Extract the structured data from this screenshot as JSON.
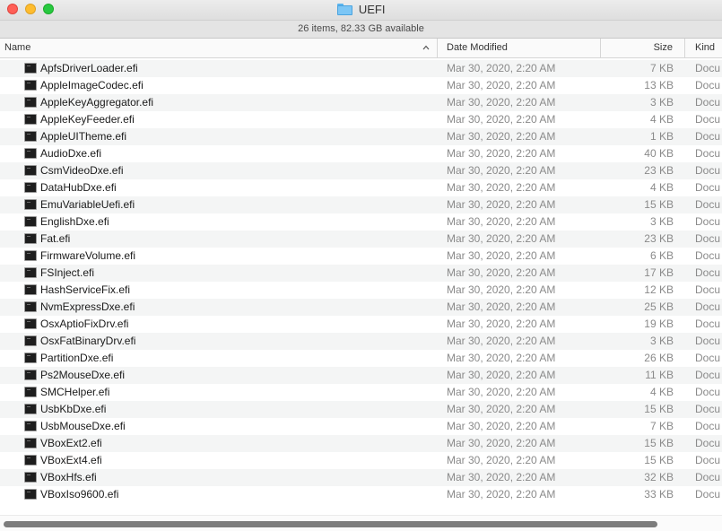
{
  "window": {
    "title": "UEFI",
    "status": "26 items, 82.33 GB available"
  },
  "columns": {
    "name": "Name",
    "date": "Date Modified",
    "size": "Size",
    "kind": "Kind"
  },
  "files": [
    {
      "name": "ApfsDriverLoader.efi",
      "date": "Mar 30, 2020, 2:20 AM",
      "size": "7 KB",
      "kind": "Docu"
    },
    {
      "name": "AppleImageCodec.efi",
      "date": "Mar 30, 2020, 2:20 AM",
      "size": "13 KB",
      "kind": "Docu"
    },
    {
      "name": "AppleKeyAggregator.efi",
      "date": "Mar 30, 2020, 2:20 AM",
      "size": "3 KB",
      "kind": "Docu"
    },
    {
      "name": "AppleKeyFeeder.efi",
      "date": "Mar 30, 2020, 2:20 AM",
      "size": "4 KB",
      "kind": "Docu"
    },
    {
      "name": "AppleUITheme.efi",
      "date": "Mar 30, 2020, 2:20 AM",
      "size": "1 KB",
      "kind": "Docu"
    },
    {
      "name": "AudioDxe.efi",
      "date": "Mar 30, 2020, 2:20 AM",
      "size": "40 KB",
      "kind": "Docu"
    },
    {
      "name": "CsmVideoDxe.efi",
      "date": "Mar 30, 2020, 2:20 AM",
      "size": "23 KB",
      "kind": "Docu"
    },
    {
      "name": "DataHubDxe.efi",
      "date": "Mar 30, 2020, 2:20 AM",
      "size": "4 KB",
      "kind": "Docu"
    },
    {
      "name": "EmuVariableUefi.efi",
      "date": "Mar 30, 2020, 2:20 AM",
      "size": "15 KB",
      "kind": "Docu"
    },
    {
      "name": "EnglishDxe.efi",
      "date": "Mar 30, 2020, 2:20 AM",
      "size": "3 KB",
      "kind": "Docu"
    },
    {
      "name": "Fat.efi",
      "date": "Mar 30, 2020, 2:20 AM",
      "size": "23 KB",
      "kind": "Docu"
    },
    {
      "name": "FirmwareVolume.efi",
      "date": "Mar 30, 2020, 2:20 AM",
      "size": "6 KB",
      "kind": "Docu"
    },
    {
      "name": "FSInject.efi",
      "date": "Mar 30, 2020, 2:20 AM",
      "size": "17 KB",
      "kind": "Docu"
    },
    {
      "name": "HashServiceFix.efi",
      "date": "Mar 30, 2020, 2:20 AM",
      "size": "12 KB",
      "kind": "Docu"
    },
    {
      "name": "NvmExpressDxe.efi",
      "date": "Mar 30, 2020, 2:20 AM",
      "size": "25 KB",
      "kind": "Docu"
    },
    {
      "name": "OsxAptioFixDrv.efi",
      "date": "Mar 30, 2020, 2:20 AM",
      "size": "19 KB",
      "kind": "Docu"
    },
    {
      "name": "OsxFatBinaryDrv.efi",
      "date": "Mar 30, 2020, 2:20 AM",
      "size": "3 KB",
      "kind": "Docu"
    },
    {
      "name": "PartitionDxe.efi",
      "date": "Mar 30, 2020, 2:20 AM",
      "size": "26 KB",
      "kind": "Docu"
    },
    {
      "name": "Ps2MouseDxe.efi",
      "date": "Mar 30, 2020, 2:20 AM",
      "size": "11 KB",
      "kind": "Docu"
    },
    {
      "name": "SMCHelper.efi",
      "date": "Mar 30, 2020, 2:20 AM",
      "size": "4 KB",
      "kind": "Docu"
    },
    {
      "name": "UsbKbDxe.efi",
      "date": "Mar 30, 2020, 2:20 AM",
      "size": "15 KB",
      "kind": "Docu"
    },
    {
      "name": "UsbMouseDxe.efi",
      "date": "Mar 30, 2020, 2:20 AM",
      "size": "7 KB",
      "kind": "Docu"
    },
    {
      "name": "VBoxExt2.efi",
      "date": "Mar 30, 2020, 2:20 AM",
      "size": "15 KB",
      "kind": "Docu"
    },
    {
      "name": "VBoxExt4.efi",
      "date": "Mar 30, 2020, 2:20 AM",
      "size": "15 KB",
      "kind": "Docu"
    },
    {
      "name": "VBoxHfs.efi",
      "date": "Mar 30, 2020, 2:20 AM",
      "size": "32 KB",
      "kind": "Docu"
    },
    {
      "name": "VBoxIso9600.efi",
      "date": "Mar 30, 2020, 2:20 AM",
      "size": "33 KB",
      "kind": "Docu"
    }
  ],
  "icons": {
    "file": "terminal-executable-icon",
    "folder": "folder-icon",
    "sort": "chevron-up-icon"
  },
  "colors": {
    "close": "#ff5f57",
    "minimize": "#febc2e",
    "maximize": "#28c840",
    "folder": "#7cc6f5"
  }
}
